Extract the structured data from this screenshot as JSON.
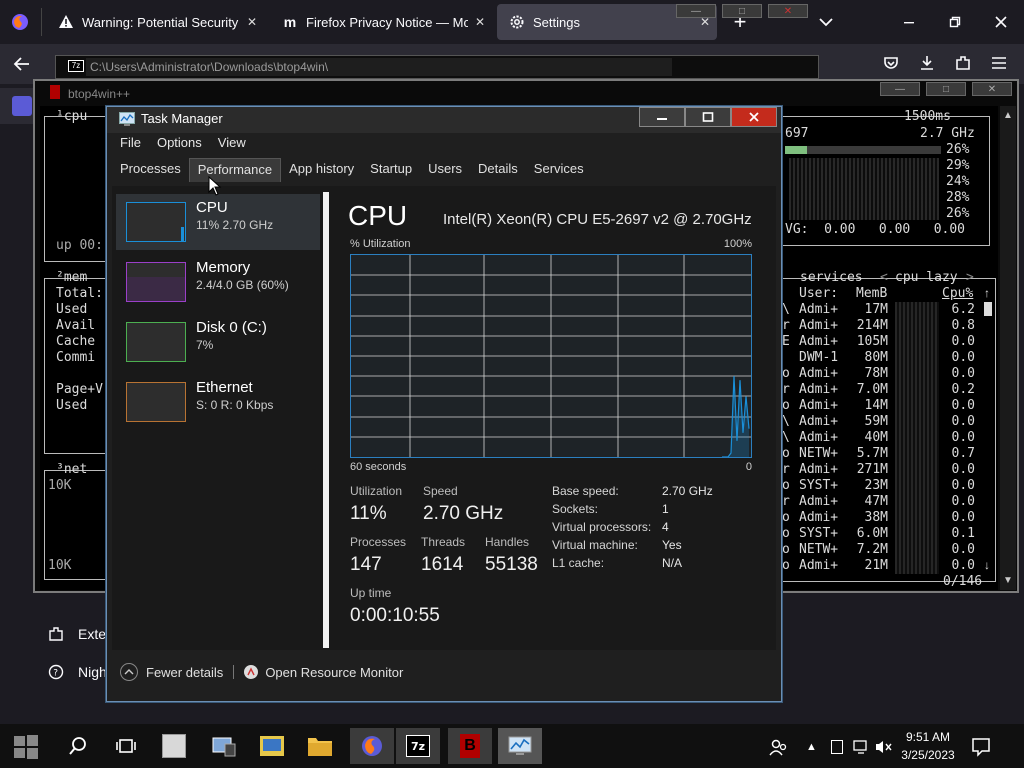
{
  "firefox": {
    "tabs": [
      {
        "title": "Warning: Potential Security Risk Ahead",
        "icon": "warning-icon"
      },
      {
        "title": "Firefox Privacy Notice — Mozilla",
        "icon": "mozilla-m-icon"
      },
      {
        "title": "Settings",
        "icon": "gear-icon"
      }
    ],
    "new_tab_label": "+",
    "sidebar": {
      "item1": "Exte",
      "item2": "Nigh"
    }
  },
  "explorer": {
    "address": "C:\\Users\\Administrator\\Downloads\\btop4win\\"
  },
  "btop": {
    "window_title": "btop4win++",
    "cpu_label": "¹cpu",
    "uptime": "up 00:",
    "refresh": "1500ms",
    "cpu_freq_partial": "697",
    "cpu_freq": "2.7 GHz",
    "core_percents": [
      "26%",
      "29%",
      "24%",
      "28%",
      "26%"
    ],
    "load_avg": "VG:  0.00   0.00   0.00",
    "mem_label": "²mem",
    "mem_rows": [
      "Total:",
      "Used",
      "Avail",
      "Cache",
      "Commi"
    ],
    "page_rows": [
      "Page+V",
      "Used"
    ],
    "net_label": "³net",
    "net_scale_top": "10K",
    "net_scale_bottom": "10K",
    "proc_header": "services",
    "proc_mode": "cpu lazy",
    "col_user": "User:",
    "col_mem": "MemB",
    "col_cpu": "Cpu%",
    "processes": [
      {
        "prefix": "\\",
        "user": "Admi+",
        "mem": "17M",
        "cpu": "6.2"
      },
      {
        "prefix": "r",
        "user": "Admi+",
        "mem": "214M",
        "cpu": "0.8"
      },
      {
        "prefix": "E",
        "user": "Admi+",
        "mem": "105M",
        "cpu": "0.0"
      },
      {
        "prefix": "",
        "user": "DWM-1",
        "mem": "80M",
        "cpu": "0.0"
      },
      {
        "prefix": "o",
        "user": "Admi+",
        "mem": "78M",
        "cpu": "0.0"
      },
      {
        "prefix": "r",
        "user": "Admi+",
        "mem": "7.0M",
        "cpu": "0.2"
      },
      {
        "prefix": "o",
        "user": "Admi+",
        "mem": "14M",
        "cpu": "0.0"
      },
      {
        "prefix": "\\",
        "user": "Admi+",
        "mem": "59M",
        "cpu": "0.0"
      },
      {
        "prefix": "\\",
        "user": "Admi+",
        "mem": "40M",
        "cpu": "0.0"
      },
      {
        "prefix": "o",
        "user": "NETW+",
        "mem": "5.7M",
        "cpu": "0.7"
      },
      {
        "prefix": "r",
        "user": "Admi+",
        "mem": "271M",
        "cpu": "0.0"
      },
      {
        "prefix": "o",
        "user": "SYST+",
        "mem": "23M",
        "cpu": "0.0"
      },
      {
        "prefix": "r",
        "user": "Admi+",
        "mem": "47M",
        "cpu": "0.0"
      },
      {
        "prefix": "o",
        "user": "Admi+",
        "mem": "38M",
        "cpu": "0.0"
      },
      {
        "prefix": "o",
        "user": "SYST+",
        "mem": "6.0M",
        "cpu": "0.1"
      },
      {
        "prefix": "o",
        "user": "NETW+",
        "mem": "7.2M",
        "cpu": "0.0"
      },
      {
        "prefix": "o",
        "user": "Admi+",
        "mem": "21M",
        "cpu": "0.0"
      }
    ],
    "proc_count": "0/146"
  },
  "task_manager": {
    "title": "Task Manager",
    "menu": [
      "File",
      "Options",
      "View"
    ],
    "tabs": [
      "Processes",
      "Performance",
      "App history",
      "Startup",
      "Users",
      "Details",
      "Services"
    ],
    "active_tab": "Performance",
    "resources": [
      {
        "name": "CPU",
        "detail": "11% 2.70 GHz",
        "color": "#1a8fd8"
      },
      {
        "name": "Memory",
        "detail": "2.4/4.0 GB (60%)",
        "color": "#9b3fc9"
      },
      {
        "name": "Disk 0 (C:)",
        "detail": "7%",
        "color": "#4caf50"
      },
      {
        "name": "Ethernet",
        "detail": "S: 0 R: 0 Kbps",
        "color": "#b87333"
      }
    ],
    "cpu": {
      "heading": "CPU",
      "model": "Intel(R) Xeon(R) CPU E5-2697 v2 @ 2.70GHz",
      "util_label": "% Utilization",
      "util_max": "100%",
      "x_left": "60 seconds",
      "x_right": "0",
      "stats": {
        "utilization_label": "Utilization",
        "utilization": "11%",
        "speed_label": "Speed",
        "speed": "2.70 GHz",
        "processes_label": "Processes",
        "processes": "147",
        "threads_label": "Threads",
        "threads": "1614",
        "handles_label": "Handles",
        "handles": "55138",
        "uptime_label": "Up time",
        "uptime": "0:00:10:55"
      },
      "specs": [
        {
          "key": "Base speed:",
          "value": "2.70 GHz"
        },
        {
          "key": "Sockets:",
          "value": "1"
        },
        {
          "key": "Virtual processors:",
          "value": "4"
        },
        {
          "key": "Virtual machine:",
          "value": "Yes"
        },
        {
          "key": "L1 cache:",
          "value": "N/A"
        }
      ],
      "graph_recent_values": [
        0,
        0,
        0,
        2,
        40,
        8,
        38,
        12,
        30,
        14
      ]
    },
    "footer": {
      "fewer_details": "Fewer details",
      "open_monitor": "Open Resource Monitor"
    }
  },
  "taskbar": {
    "time": "9:51 AM",
    "date": "3/25/2023"
  }
}
